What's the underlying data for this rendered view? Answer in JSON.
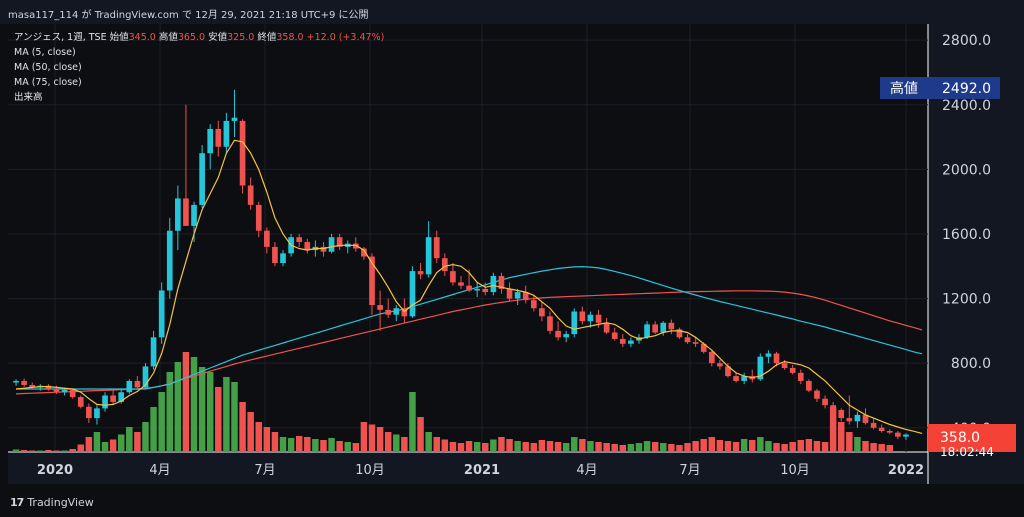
{
  "header": {
    "share_text": "masa117_114 が TradingView.com で 12月 29, 2021 21:18 UTC+9 に公開"
  },
  "legend": {
    "symbol": "アンジェス, 1週, TSE",
    "open_label": "始値",
    "open_value": "345.0",
    "high_label": "高値",
    "high_value": "365.0",
    "low_label": "安値",
    "low_value": "325.0",
    "close_label": "終値",
    "close_value": "358.0",
    "change": "+12.0 (+3.47%)",
    "ma1": "MA (5, close)",
    "ma2": "MA (50, close)",
    "ma3": "MA (75, close)",
    "volume": "出来高"
  },
  "footer": {
    "logo_text": "TradingView"
  },
  "colors": {
    "up": "#26c6da",
    "down": "#ef5350",
    "vol_up": "#43a047",
    "vol_down": "#ef5350",
    "ma5": "#f6c343",
    "ma50": "#26c6da",
    "ma75": "#ef5350",
    "high_badge": "#1e3a8a",
    "price_badge": "#f44336"
  },
  "chart_data": {
    "type": "candlestick",
    "y_ticks": [
      "2800.0",
      "2400.0",
      "2000.0",
      "1600.0",
      "1200.0",
      "800.0",
      "400.0"
    ],
    "ylim": [
      250,
      2900
    ],
    "x_ticks": [
      "2020",
      "4月",
      "7月",
      "10月",
      "2021",
      "4月",
      "7月",
      "10月",
      "2022"
    ],
    "high_badge": {
      "label": "高値",
      "value": "2492.0"
    },
    "last_price": {
      "value": "358.0",
      "countdown": "18:02:44"
    },
    "candles": [
      [
        680,
        700,
        660,
        690
      ],
      [
        690,
        705,
        655,
        665
      ],
      [
        665,
        680,
        640,
        650
      ],
      [
        650,
        670,
        630,
        660
      ],
      [
        660,
        670,
        630,
        640
      ],
      [
        640,
        660,
        610,
        620
      ],
      [
        620,
        650,
        600,
        635
      ],
      [
        635,
        645,
        580,
        590
      ],
      [
        590,
        600,
        520,
        530
      ],
      [
        530,
        550,
        430,
        460
      ],
      [
        460,
        540,
        420,
        520
      ],
      [
        520,
        620,
        500,
        600
      ],
      [
        600,
        640,
        540,
        560
      ],
      [
        560,
        640,
        550,
        620
      ],
      [
        620,
        700,
        610,
        690
      ],
      [
        690,
        720,
        640,
        650
      ],
      [
        650,
        800,
        640,
        780
      ],
      [
        780,
        1000,
        760,
        960
      ],
      [
        960,
        1300,
        920,
        1250
      ],
      [
        1250,
        1700,
        1200,
        1620
      ],
      [
        1620,
        1900,
        1500,
        1820
      ],
      [
        1820,
        2400,
        1700,
        1650
      ],
      [
        1650,
        1800,
        1550,
        1780
      ],
      [
        1780,
        2150,
        1760,
        2100
      ],
      [
        2100,
        2280,
        2000,
        2250
      ],
      [
        2250,
        2300,
        2080,
        2140
      ],
      [
        2140,
        2350,
        2100,
        2300
      ],
      [
        2300,
        2492,
        2200,
        2320
      ],
      [
        2300,
        2310,
        1850,
        1900
      ],
      [
        1900,
        1950,
        1750,
        1780
      ],
      [
        1780,
        1800,
        1580,
        1620
      ],
      [
        1620,
        1640,
        1480,
        1520
      ],
      [
        1520,
        1550,
        1400,
        1420
      ],
      [
        1420,
        1500,
        1400,
        1480
      ],
      [
        1480,
        1600,
        1460,
        1580
      ],
      [
        1580,
        1600,
        1520,
        1550
      ],
      [
        1550,
        1570,
        1480,
        1500
      ],
      [
        1500,
        1560,
        1460,
        1520
      ],
      [
        1520,
        1550,
        1460,
        1490
      ],
      [
        1490,
        1600,
        1480,
        1580
      ],
      [
        1580,
        1600,
        1500,
        1520
      ],
      [
        1520,
        1560,
        1480,
        1540
      ],
      [
        1540,
        1580,
        1490,
        1510
      ],
      [
        1510,
        1520,
        1440,
        1460
      ],
      [
        1460,
        1480,
        1100,
        1160
      ],
      [
        1160,
        1250,
        1000,
        1130
      ],
      [
        1130,
        1200,
        1080,
        1100
      ],
      [
        1100,
        1160,
        1060,
        1140
      ],
      [
        1140,
        1200,
        1050,
        1090
      ],
      [
        1090,
        1400,
        1080,
        1370
      ],
      [
        1370,
        1420,
        1320,
        1350
      ],
      [
        1350,
        1680,
        1330,
        1580
      ],
      [
        1580,
        1620,
        1420,
        1450
      ],
      [
        1450,
        1480,
        1340,
        1370
      ],
      [
        1370,
        1420,
        1280,
        1300
      ],
      [
        1300,
        1340,
        1260,
        1280
      ],
      [
        1280,
        1380,
        1240,
        1250
      ],
      [
        1250,
        1300,
        1210,
        1260
      ],
      [
        1260,
        1300,
        1220,
        1240
      ],
      [
        1240,
        1360,
        1220,
        1340
      ],
      [
        1340,
        1360,
        1230,
        1260
      ],
      [
        1260,
        1300,
        1180,
        1200
      ],
      [
        1200,
        1260,
        1160,
        1240
      ],
      [
        1240,
        1280,
        1170,
        1190
      ],
      [
        1190,
        1220,
        1120,
        1140
      ],
      [
        1140,
        1180,
        1060,
        1090
      ],
      [
        1090,
        1120,
        980,
        1000
      ],
      [
        1000,
        1060,
        940,
        960
      ],
      [
        960,
        1000,
        930,
        980
      ],
      [
        980,
        1140,
        960,
        1120
      ],
      [
        1120,
        1150,
        1040,
        1060
      ],
      [
        1060,
        1120,
        1020,
        1100
      ],
      [
        1100,
        1130,
        1020,
        1050
      ],
      [
        1050,
        1080,
        980,
        990
      ],
      [
        990,
        1020,
        940,
        950
      ],
      [
        950,
        980,
        900,
        920
      ],
      [
        920,
        960,
        900,
        940
      ],
      [
        940,
        980,
        920,
        960
      ],
      [
        960,
        1060,
        950,
        1040
      ],
      [
        1040,
        1060,
        980,
        990
      ],
      [
        990,
        1060,
        970,
        1050
      ],
      [
        1050,
        1070,
        980,
        1010
      ],
      [
        1010,
        1020,
        950,
        960
      ],
      [
        960,
        980,
        920,
        930
      ],
      [
        930,
        960,
        900,
        920
      ],
      [
        920,
        930,
        860,
        870
      ],
      [
        870,
        880,
        780,
        800
      ],
      [
        800,
        820,
        760,
        780
      ],
      [
        780,
        800,
        710,
        720
      ],
      [
        720,
        740,
        680,
        690
      ],
      [
        690,
        740,
        670,
        720
      ],
      [
        720,
        760,
        680,
        700
      ],
      [
        700,
        860,
        690,
        840
      ],
      [
        840,
        880,
        800,
        860
      ],
      [
        860,
        870,
        780,
        800
      ],
      [
        800,
        820,
        760,
        770
      ],
      [
        770,
        790,
        730,
        740
      ],
      [
        740,
        760,
        670,
        690
      ],
      [
        690,
        700,
        620,
        630
      ],
      [
        630,
        640,
        560,
        580
      ],
      [
        580,
        600,
        520,
        540
      ],
      [
        540,
        560,
        490,
        510
      ],
      [
        510,
        520,
        440,
        460
      ],
      [
        460,
        600,
        420,
        440
      ],
      [
        440,
        500,
        400,
        480
      ],
      [
        480,
        520,
        420,
        430
      ],
      [
        430,
        460,
        390,
        400
      ],
      [
        400,
        420,
        370,
        380
      ],
      [
        380,
        390,
        360,
        370
      ],
      [
        370,
        380,
        330,
        345
      ],
      [
        345,
        365,
        325,
        358
      ]
    ],
    "volume": [
      5,
      4,
      3,
      3,
      4,
      3,
      3,
      6,
      15,
      30,
      40,
      20,
      25,
      35,
      50,
      40,
      60,
      90,
      120,
      160,
      180,
      200,
      190,
      170,
      160,
      130,
      150,
      140,
      100,
      80,
      60,
      50,
      40,
      30,
      28,
      32,
      30,
      26,
      24,
      28,
      22,
      20,
      18,
      60,
      55,
      50,
      40,
      35,
      30,
      120,
      70,
      40,
      30,
      25,
      20,
      18,
      22,
      20,
      18,
      25,
      30,
      26,
      22,
      20,
      18,
      24,
      22,
      20,
      18,
      30,
      26,
      22,
      20,
      18,
      16,
      14,
      16,
      18,
      22,
      20,
      18,
      16,
      14,
      18,
      22,
      26,
      30,
      24,
      22,
      20,
      26,
      24,
      30,
      22,
      18,
      16,
      20,
      24,
      26,
      22,
      20,
      90,
      60,
      40,
      30,
      22,
      18,
      16,
      14
    ],
    "ma5": [
      640,
      645,
      650,
      655,
      655,
      650,
      645,
      640,
      620,
      580,
      545,
      540,
      545,
      565,
      600,
      625,
      665,
      740,
      860,
      1040,
      1260,
      1430,
      1600,
      1750,
      1850,
      1950,
      2100,
      2180,
      2170,
      2100,
      2000,
      1860,
      1700,
      1600,
      1530,
      1510,
      1500,
      1510,
      1510,
      1520,
      1530,
      1530,
      1530,
      1500,
      1420,
      1350,
      1270,
      1180,
      1120,
      1160,
      1190,
      1280,
      1360,
      1400,
      1410,
      1400,
      1360,
      1300,
      1270,
      1280,
      1270,
      1260,
      1250,
      1240,
      1220,
      1180,
      1140,
      1080,
      1030,
      1010,
      1020,
      1030,
      1040,
      1050,
      1040,
      1010,
      970,
      950,
      960,
      970,
      990,
      1000,
      1000,
      990,
      960,
      920,
      880,
      830,
      780,
      740,
      720,
      710,
      720,
      750,
      790,
      810,
      800,
      790,
      770,
      730,
      690,
      640,
      590,
      540,
      510,
      480,
      460,
      440,
      420,
      405,
      390,
      378,
      365
    ],
    "ma50": [
      640,
      640,
      640,
      640,
      640,
      640,
      640,
      640,
      640,
      640,
      640,
      640,
      640,
      640,
      640,
      640,
      640,
      650,
      660,
      670,
      690,
      710,
      730,
      750,
      770,
      790,
      810,
      830,
      850,
      865,
      880,
      895,
      910,
      925,
      940,
      955,
      970,
      985,
      1000,
      1015,
      1030,
      1045,
      1060,
      1075,
      1090,
      1105,
      1115,
      1125,
      1135,
      1150,
      1165,
      1180,
      1195,
      1210,
      1225,
      1240,
      1255,
      1270,
      1285,
      1300,
      1315,
      1330,
      1340,
      1350,
      1360,
      1370,
      1378,
      1386,
      1392,
      1396,
      1398,
      1395,
      1390,
      1380,
      1368,
      1356,
      1342,
      1328,
      1312,
      1296,
      1280,
      1265,
      1250,
      1236,
      1222,
      1208,
      1195,
      1182,
      1170,
      1158,
      1146,
      1134,
      1122,
      1110,
      1098,
      1086,
      1074,
      1060,
      1048,
      1036,
      1024,
      1010,
      996,
      982,
      968,
      954,
      940,
      926,
      912,
      898,
      884,
      870,
      858
    ],
    "ma75": [
      610,
      612,
      614,
      616,
      618,
      620,
      622,
      624,
      626,
      628,
      630,
      632,
      634,
      636,
      638,
      640,
      645,
      650,
      660,
      675,
      690,
      705,
      720,
      735,
      750,
      765,
      780,
      795,
      808,
      820,
      832,
      844,
      856,
      868,
      880,
      892,
      904,
      916,
      928,
      940,
      952,
      964,
      976,
      988,
      1000,
      1012,
      1024,
      1036,
      1048,
      1060,
      1072,
      1084,
      1096,
      1108,
      1120,
      1130,
      1140,
      1150,
      1160,
      1168,
      1176,
      1184,
      1190,
      1196,
      1200,
      1204,
      1208,
      1210,
      1212,
      1214,
      1216,
      1218,
      1220,
      1222,
      1224,
      1226,
      1228,
      1230,
      1232,
      1234,
      1236,
      1238,
      1240,
      1242,
      1243,
      1244,
      1245,
      1246,
      1247,
      1248,
      1248,
      1248,
      1247,
      1246,
      1244,
      1240,
      1234,
      1226,
      1216,
      1204,
      1190,
      1174,
      1158,
      1142,
      1126,
      1110,
      1094,
      1078,
      1062,
      1048,
      1034,
      1020,
      1006
    ]
  }
}
